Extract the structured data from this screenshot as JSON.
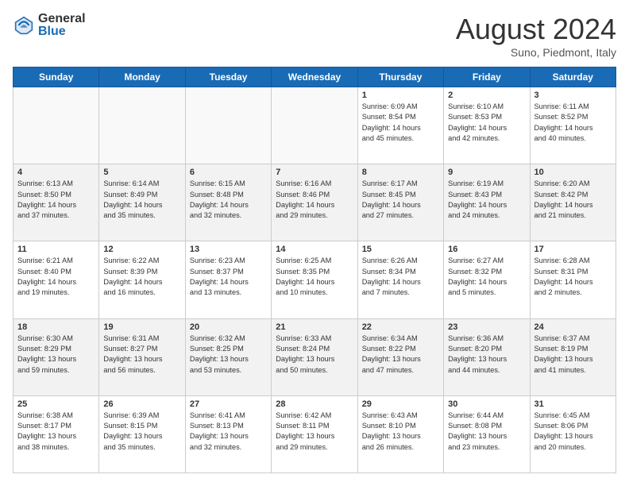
{
  "header": {
    "logo_general": "General",
    "logo_blue": "Blue",
    "month_title": "August 2024",
    "location": "Suno, Piedmont, Italy"
  },
  "calendar": {
    "days_of_week": [
      "Sunday",
      "Monday",
      "Tuesday",
      "Wednesday",
      "Thursday",
      "Friday",
      "Saturday"
    ],
    "weeks": [
      [
        {
          "day": "",
          "info": ""
        },
        {
          "day": "",
          "info": ""
        },
        {
          "day": "",
          "info": ""
        },
        {
          "day": "",
          "info": ""
        },
        {
          "day": "1",
          "info": "Sunrise: 6:09 AM\nSunset: 8:54 PM\nDaylight: 14 hours\nand 45 minutes."
        },
        {
          "day": "2",
          "info": "Sunrise: 6:10 AM\nSunset: 8:53 PM\nDaylight: 14 hours\nand 42 minutes."
        },
        {
          "day": "3",
          "info": "Sunrise: 6:11 AM\nSunset: 8:52 PM\nDaylight: 14 hours\nand 40 minutes."
        }
      ],
      [
        {
          "day": "4",
          "info": "Sunrise: 6:13 AM\nSunset: 8:50 PM\nDaylight: 14 hours\nand 37 minutes."
        },
        {
          "day": "5",
          "info": "Sunrise: 6:14 AM\nSunset: 8:49 PM\nDaylight: 14 hours\nand 35 minutes."
        },
        {
          "day": "6",
          "info": "Sunrise: 6:15 AM\nSunset: 8:48 PM\nDaylight: 14 hours\nand 32 minutes."
        },
        {
          "day": "7",
          "info": "Sunrise: 6:16 AM\nSunset: 8:46 PM\nDaylight: 14 hours\nand 29 minutes."
        },
        {
          "day": "8",
          "info": "Sunrise: 6:17 AM\nSunset: 8:45 PM\nDaylight: 14 hours\nand 27 minutes."
        },
        {
          "day": "9",
          "info": "Sunrise: 6:19 AM\nSunset: 8:43 PM\nDaylight: 14 hours\nand 24 minutes."
        },
        {
          "day": "10",
          "info": "Sunrise: 6:20 AM\nSunset: 8:42 PM\nDaylight: 14 hours\nand 21 minutes."
        }
      ],
      [
        {
          "day": "11",
          "info": "Sunrise: 6:21 AM\nSunset: 8:40 PM\nDaylight: 14 hours\nand 19 minutes."
        },
        {
          "day": "12",
          "info": "Sunrise: 6:22 AM\nSunset: 8:39 PM\nDaylight: 14 hours\nand 16 minutes."
        },
        {
          "day": "13",
          "info": "Sunrise: 6:23 AM\nSunset: 8:37 PM\nDaylight: 14 hours\nand 13 minutes."
        },
        {
          "day": "14",
          "info": "Sunrise: 6:25 AM\nSunset: 8:35 PM\nDaylight: 14 hours\nand 10 minutes."
        },
        {
          "day": "15",
          "info": "Sunrise: 6:26 AM\nSunset: 8:34 PM\nDaylight: 14 hours\nand 7 minutes."
        },
        {
          "day": "16",
          "info": "Sunrise: 6:27 AM\nSunset: 8:32 PM\nDaylight: 14 hours\nand 5 minutes."
        },
        {
          "day": "17",
          "info": "Sunrise: 6:28 AM\nSunset: 8:31 PM\nDaylight: 14 hours\nand 2 minutes."
        }
      ],
      [
        {
          "day": "18",
          "info": "Sunrise: 6:30 AM\nSunset: 8:29 PM\nDaylight: 13 hours\nand 59 minutes."
        },
        {
          "day": "19",
          "info": "Sunrise: 6:31 AM\nSunset: 8:27 PM\nDaylight: 13 hours\nand 56 minutes."
        },
        {
          "day": "20",
          "info": "Sunrise: 6:32 AM\nSunset: 8:25 PM\nDaylight: 13 hours\nand 53 minutes."
        },
        {
          "day": "21",
          "info": "Sunrise: 6:33 AM\nSunset: 8:24 PM\nDaylight: 13 hours\nand 50 minutes."
        },
        {
          "day": "22",
          "info": "Sunrise: 6:34 AM\nSunset: 8:22 PM\nDaylight: 13 hours\nand 47 minutes."
        },
        {
          "day": "23",
          "info": "Sunrise: 6:36 AM\nSunset: 8:20 PM\nDaylight: 13 hours\nand 44 minutes."
        },
        {
          "day": "24",
          "info": "Sunrise: 6:37 AM\nSunset: 8:19 PM\nDaylight: 13 hours\nand 41 minutes."
        }
      ],
      [
        {
          "day": "25",
          "info": "Sunrise: 6:38 AM\nSunset: 8:17 PM\nDaylight: 13 hours\nand 38 minutes."
        },
        {
          "day": "26",
          "info": "Sunrise: 6:39 AM\nSunset: 8:15 PM\nDaylight: 13 hours\nand 35 minutes."
        },
        {
          "day": "27",
          "info": "Sunrise: 6:41 AM\nSunset: 8:13 PM\nDaylight: 13 hours\nand 32 minutes."
        },
        {
          "day": "28",
          "info": "Sunrise: 6:42 AM\nSunset: 8:11 PM\nDaylight: 13 hours\nand 29 minutes."
        },
        {
          "day": "29",
          "info": "Sunrise: 6:43 AM\nSunset: 8:10 PM\nDaylight: 13 hours\nand 26 minutes."
        },
        {
          "day": "30",
          "info": "Sunrise: 6:44 AM\nSunset: 8:08 PM\nDaylight: 13 hours\nand 23 minutes."
        },
        {
          "day": "31",
          "info": "Sunrise: 6:45 AM\nSunset: 8:06 PM\nDaylight: 13 hours\nand 20 minutes."
        }
      ]
    ]
  }
}
